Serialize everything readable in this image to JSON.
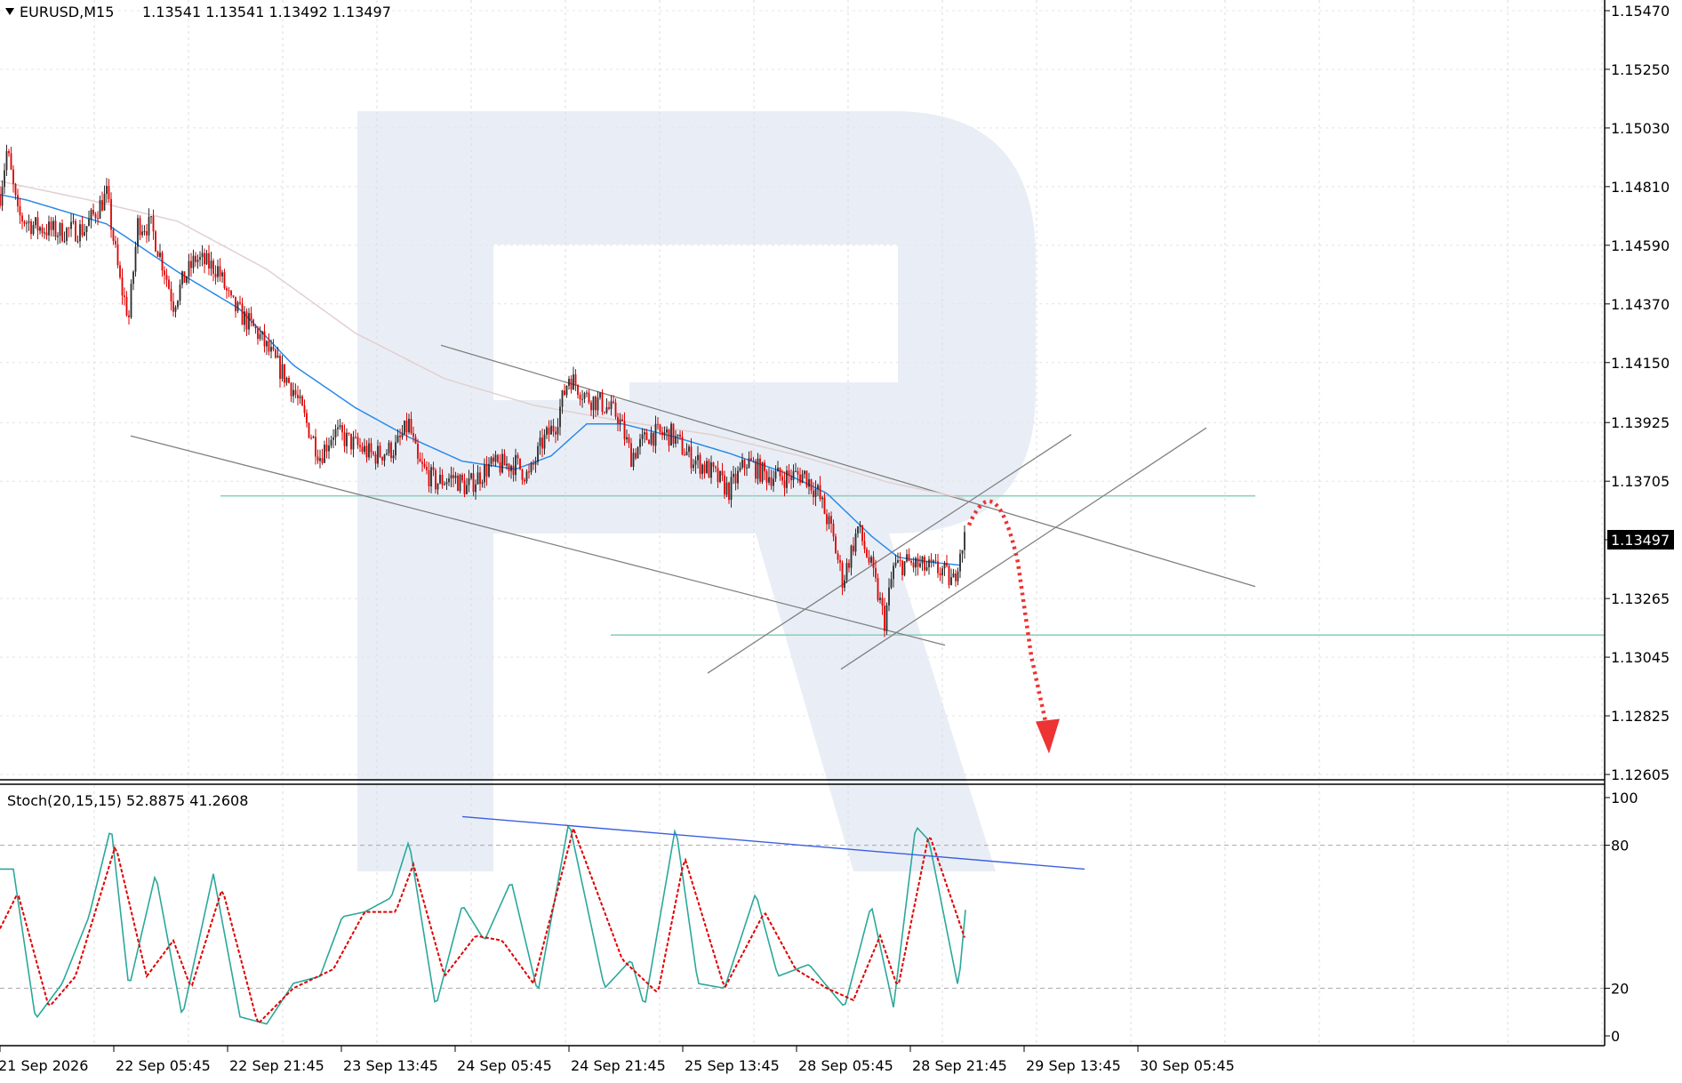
{
  "header": {
    "symbol": "EURUSD,M15",
    "quote": "1.13541 1.13541 1.13492 1.13497"
  },
  "colors": {
    "bull": "#2b2b2b",
    "bear": "#e00000",
    "ma_fast": "#2a8ae8",
    "ma_slow": "#e3cfcf",
    "level": "#8fd1c0",
    "trend": "#808080",
    "forecast": "#ee3333",
    "stoch_main": "#2ba89a",
    "stoch_signal": "#e00000",
    "stoch_trend": "#3a5fe0",
    "watermark": "#e9eef6"
  },
  "chart_data": {
    "type": "candlestick",
    "symbol": "EURUSD",
    "timeframe": "M15",
    "current_price": 1.13497,
    "current_price_label": "1.13497",
    "y_ticks": [
      "1.15470",
      "1.15250",
      "1.15030",
      "1.14810",
      "1.14590",
      "1.14370",
      "1.14150",
      "1.13925",
      "1.13705",
      "1.13265",
      "1.13045",
      "1.12825",
      "1.12605"
    ],
    "y_range": [
      1.12585,
      1.1551
    ],
    "x_labels": [
      "21 Sep 2026",
      "22 Sep 05:45",
      "22 Sep 21:45",
      "23 Sep 13:45",
      "24 Sep 05:45",
      "24 Sep 21:45",
      "25 Sep 13:45",
      "28 Sep 05:45",
      "28 Sep 21:45",
      "29 Sep 13:45",
      "30 Sep 05:45"
    ],
    "price_path": [
      [
        0,
        1.1478
      ],
      [
        8,
        1.1495
      ],
      [
        20,
        1.147
      ],
      [
        40,
        1.1466
      ],
      [
        65,
        1.1464
      ],
      [
        95,
        1.1465
      ],
      [
        120,
        1.1478
      ],
      [
        135,
        1.1445
      ],
      [
        145,
        1.1432
      ],
      [
        155,
        1.1467
      ],
      [
        170,
        1.1466
      ],
      [
        185,
        1.145
      ],
      [
        195,
        1.1437
      ],
      [
        205,
        1.1445
      ],
      [
        220,
        1.1454
      ],
      [
        245,
        1.145
      ],
      [
        260,
        1.1437
      ],
      [
        290,
        1.1426
      ],
      [
        310,
        1.1415
      ],
      [
        330,
        1.1405
      ],
      [
        345,
        1.1392
      ],
      [
        360,
        1.138
      ],
      [
        375,
        1.1389
      ],
      [
        395,
        1.1385
      ],
      [
        420,
        1.138
      ],
      [
        445,
        1.1383
      ],
      [
        460,
        1.1392
      ],
      [
        470,
        1.1377
      ],
      [
        490,
        1.137
      ],
      [
        510,
        1.1372
      ],
      [
        525,
        1.1368
      ],
      [
        550,
        1.1376
      ],
      [
        580,
        1.1377
      ],
      [
        595,
        1.1372
      ],
      [
        610,
        1.1385
      ],
      [
        625,
        1.1392
      ],
      [
        640,
        1.141
      ],
      [
        660,
        1.1402
      ],
      [
        675,
        1.14
      ],
      [
        695,
        1.1395
      ],
      [
        710,
        1.138
      ],
      [
        730,
        1.1388
      ],
      [
        755,
        1.1388
      ],
      [
        775,
        1.138
      ],
      [
        800,
        1.1374
      ],
      [
        820,
        1.1367
      ],
      [
        840,
        1.1378
      ],
      [
        860,
        1.1373
      ],
      [
        880,
        1.1372
      ],
      [
        905,
        1.1373
      ],
      [
        920,
        1.1366
      ],
      [
        935,
        1.1352
      ],
      [
        948,
        1.1333
      ],
      [
        965,
        1.1353
      ],
      [
        980,
        1.1338
      ],
      [
        995,
        1.1318
      ],
      [
        1005,
        1.1338
      ],
      [
        1020,
        1.134
      ],
      [
        1040,
        1.1338
      ],
      [
        1060,
        1.1337
      ],
      [
        1072,
        1.1332
      ],
      [
        1080,
        1.1345
      ],
      [
        1086,
        1.13497
      ]
    ],
    "ma_fast_path": [
      [
        0,
        1.1478
      ],
      [
        30,
        1.1476
      ],
      [
        120,
        1.1467
      ],
      [
        200,
        1.1449
      ],
      [
        270,
        1.1435
      ],
      [
        330,
        1.1414
      ],
      [
        400,
        1.1398
      ],
      [
        460,
        1.1387
      ],
      [
        520,
        1.1378
      ],
      [
        580,
        1.1375
      ],
      [
        620,
        1.138
      ],
      [
        660,
        1.1392
      ],
      [
        700,
        1.1392
      ],
      [
        760,
        1.1387
      ],
      [
        820,
        1.1381
      ],
      [
        880,
        1.1374
      ],
      [
        930,
        1.1366
      ],
      [
        980,
        1.135
      ],
      [
        1010,
        1.1342
      ],
      [
        1050,
        1.134
      ],
      [
        1080,
        1.1339
      ]
    ],
    "ma_slow_path": [
      [
        0,
        1.1483
      ],
      [
        100,
        1.1476
      ],
      [
        200,
        1.1468
      ],
      [
        300,
        1.145
      ],
      [
        400,
        1.1426
      ],
      [
        500,
        1.1409
      ],
      [
        600,
        1.1399
      ],
      [
        700,
        1.1393
      ],
      [
        800,
        1.1388
      ],
      [
        900,
        1.138
      ],
      [
        1000,
        1.137
      ],
      [
        1085,
        1.1364
      ]
    ],
    "horizontal_levels": [
      1.1365,
      1.13128
    ],
    "trendlines": [
      {
        "from": [
          147,
          1.13875
        ],
        "to": [
          1063,
          1.1309
        ]
      },
      {
        "from": [
          496,
          1.14215
        ],
        "to": [
          1412,
          1.1331
        ]
      },
      {
        "from": [
          796,
          1.12985
        ],
        "to": [
          1205,
          1.1388
        ]
      },
      {
        "from": [
          946,
          1.13
        ],
        "to": [
          1357,
          1.13905
        ]
      }
    ],
    "forecast_path": [
      [
        1090,
        1.1354
      ],
      [
        1120,
        1.1369
      ],
      [
        1145,
        1.134
      ],
      [
        1160,
        1.1305
      ],
      [
        1178,
        1.127
      ]
    ],
    "stochastic": {
      "label": "Stoch(20,15,15) 52.8875 41.2608",
      "params": [
        20,
        15,
        15
      ],
      "main_value": 52.8875,
      "signal_value": 41.2608,
      "levels": [
        20,
        80
      ],
      "y_ticks": [
        "100",
        "80",
        "20",
        "0"
      ],
      "y_range": [
        0,
        100
      ],
      "main_path": [
        [
          0,
          70
        ],
        [
          15,
          70
        ],
        [
          40,
          7
        ],
        [
          70,
          22
        ],
        [
          100,
          50
        ],
        [
          125,
          88
        ],
        [
          145,
          20
        ],
        [
          175,
          68
        ],
        [
          205,
          8
        ],
        [
          240,
          68
        ],
        [
          270,
          8
        ],
        [
          300,
          5
        ],
        [
          330,
          22
        ],
        [
          360,
          25
        ],
        [
          385,
          50
        ],
        [
          410,
          52
        ],
        [
          440,
          58
        ],
        [
          460,
          82
        ],
        [
          490,
          12
        ],
        [
          520,
          55
        ],
        [
          545,
          40
        ],
        [
          575,
          65
        ],
        [
          605,
          18
        ],
        [
          640,
          90
        ],
        [
          680,
          20
        ],
        [
          710,
          32
        ],
        [
          725,
          12
        ],
        [
          760,
          88
        ],
        [
          785,
          22
        ],
        [
          815,
          20
        ],
        [
          850,
          60
        ],
        [
          875,
          25
        ],
        [
          910,
          30
        ],
        [
          950,
          12
        ],
        [
          980,
          55
        ],
        [
          1005,
          12
        ],
        [
          1030,
          88
        ],
        [
          1045,
          82
        ],
        [
          1078,
          20
        ],
        [
          1086,
          52.89
        ]
      ],
      "signal_path": [
        [
          0,
          45
        ],
        [
          20,
          60
        ],
        [
          55,
          12
        ],
        [
          85,
          25
        ],
        [
          130,
          80
        ],
        [
          165,
          25
        ],
        [
          195,
          40
        ],
        [
          215,
          20
        ],
        [
          250,
          62
        ],
        [
          290,
          5
        ],
        [
          330,
          20
        ],
        [
          375,
          28
        ],
        [
          410,
          52
        ],
        [
          445,
          52
        ],
        [
          465,
          72
        ],
        [
          500,
          25
        ],
        [
          535,
          42
        ],
        [
          565,
          40
        ],
        [
          600,
          22
        ],
        [
          645,
          87
        ],
        [
          700,
          32
        ],
        [
          740,
          18
        ],
        [
          770,
          75
        ],
        [
          815,
          20
        ],
        [
          860,
          52
        ],
        [
          895,
          28
        ],
        [
          930,
          20
        ],
        [
          960,
          15
        ],
        [
          990,
          42
        ],
        [
          1010,
          20
        ],
        [
          1045,
          85
        ],
        [
          1085,
          41.26
        ]
      ],
      "trendline": {
        "from": [
          520,
          92
        ],
        "to": [
          1220,
          70
        ]
      }
    }
  }
}
